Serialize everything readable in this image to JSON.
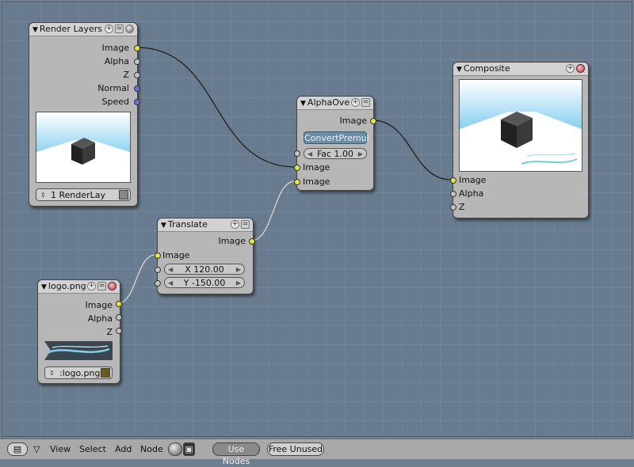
{
  "nodes": {
    "render_layers": {
      "title": "Render Layers",
      "outputs": [
        "Image",
        "Alpha",
        "Z",
        "Normal",
        "Speed"
      ],
      "layer_select": "1 RenderLay"
    },
    "alpha_over": {
      "title": "AlphaOve",
      "output": "Image",
      "convert_button": "ConvertPremul",
      "fac": "Fac 1.00",
      "inputs": [
        "Image",
        "Image"
      ]
    },
    "composite": {
      "title": "Composite",
      "inputs": [
        "Image",
        "Alpha",
        "Z"
      ]
    },
    "translate": {
      "title": "Translate",
      "output": "Image",
      "input": "Image",
      "x_field": "X 120.00",
      "y_field": "Y -150.00"
    },
    "image": {
      "title": "logo.png",
      "outputs": [
        "Image",
        "Alpha",
        "Z"
      ],
      "image_select": ":logo.png"
    }
  },
  "footer": {
    "menus": [
      "View",
      "Select",
      "Add",
      "Node"
    ],
    "use_nodes": "Use Nodes",
    "free_unused": "Free Unused"
  },
  "colors": {
    "canvas": "#687b8f",
    "node_body": "#b7b7b7",
    "image_socket": "#e6e63c",
    "value_socket": "#c4c4c4",
    "vector_socket": "#6f6fd8"
  },
  "icons": [
    "editor-type-icon",
    "plus-icon",
    "collapse-icon",
    "preview-sphere-icon",
    "close-icon",
    "image-browse-icon"
  ]
}
